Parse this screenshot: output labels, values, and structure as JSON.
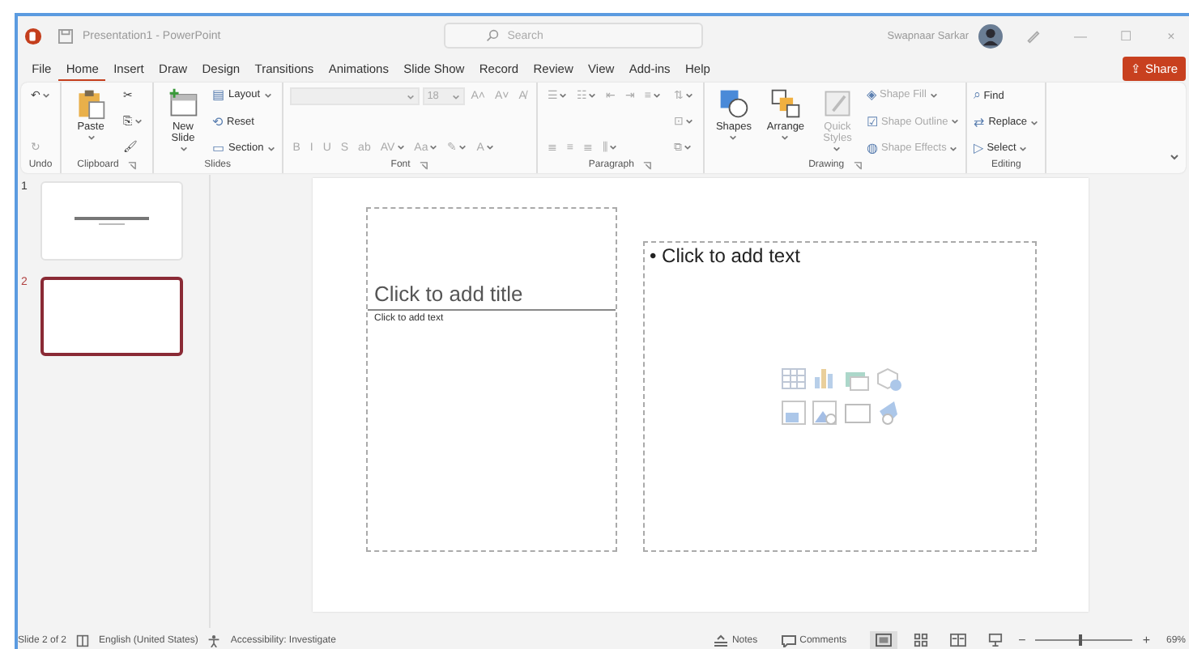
{
  "window": {
    "title": "Presentation1 - PowerPoint",
    "search_placeholder": "Search",
    "user": "Swapnaar Sarkar",
    "controls": [
      "—",
      "☐",
      "×"
    ]
  },
  "menu": [
    {
      "label": "File",
      "selected": false
    },
    {
      "label": "Home",
      "selected": true
    },
    {
      "label": "Insert",
      "selected": false
    },
    {
      "label": "Draw",
      "selected": false
    },
    {
      "label": "Design",
      "selected": false
    },
    {
      "label": "Transitions",
      "selected": false
    },
    {
      "label": "Animations",
      "selected": false
    },
    {
      "label": "Slide Show",
      "selected": false
    },
    {
      "label": "Record",
      "selected": false
    },
    {
      "label": "Review",
      "selected": false
    },
    {
      "label": "View",
      "selected": false
    },
    {
      "label": "Add-ins",
      "selected": false
    },
    {
      "label": "Help",
      "selected": false
    }
  ],
  "share": {
    "label": "Share",
    "icon": "⇪"
  },
  "ribbon": [
    {
      "label": "Undo",
      "launcher": false,
      "columns": [
        [
          [
            {
              "kind": "glyph",
              "text": "↶",
              "dropdown": true,
              "disabled": false
            }
          ],
          [
            {
              "kind": "glyph",
              "text": "↻",
              "dropdown": false,
              "disabled": true
            }
          ]
        ]
      ]
    },
    {
      "label": "Clipboard",
      "launcher": true,
      "columns": [
        [
          [
            {
              "kind": "paste",
              "label": "Paste",
              "dropdown": true,
              "disabled": false
            }
          ]
        ],
        [
          [
            {
              "kind": "glyph",
              "text": "✂",
              "dropdown": false,
              "disabled": false
            }
          ],
          [
            {
              "kind": "glyph",
              "text": "⎘",
              "dropdown": true,
              "disabled": false
            }
          ],
          [
            {
              "kind": "glyph",
              "text": "🖌",
              "dropdown": false,
              "disabled": false
            }
          ]
        ]
      ]
    },
    {
      "label": "Slides",
      "launcher": false,
      "columns": [
        [
          [
            {
              "kind": "newslide",
              "label": "New Slide",
              "dropdown": true,
              "disabled": false
            }
          ]
        ],
        [
          [
            {
              "kind": "small",
              "icon": "▤",
              "label": "Layout",
              "dropdown": true,
              "disabled": false
            }
          ],
          [
            {
              "kind": "small",
              "icon": "⟲",
              "label": "Reset",
              "dropdown": false,
              "disabled": false
            }
          ],
          [
            {
              "kind": "small",
              "icon": "▭",
              "label": "Section",
              "dropdown": true,
              "disabled": false
            }
          ]
        ]
      ]
    },
    {
      "label": "Font",
      "launcher": true,
      "columns": [
        [
          [
            {
              "kind": "field",
              "text": "",
              "wide": true,
              "disabled": true
            },
            {
              "kind": "field",
              "text": "18",
              "wide": false,
              "disabled": true
            },
            {
              "kind": "glyph",
              "text": "A˄",
              "dropdown": false,
              "disabled": true
            },
            {
              "kind": "glyph",
              "text": "A˅",
              "dropdown": false,
              "disabled": true
            },
            {
              "kind": "glyph",
              "text": "A̸",
              "dropdown": false,
              "disabled": true
            }
          ],
          [
            {
              "kind": "glyph",
              "text": "B",
              "dropdown": false,
              "disabled": true
            },
            {
              "kind": "glyph",
              "text": "I",
              "dropdown": false,
              "disabled": true
            },
            {
              "kind": "glyph",
              "text": "U",
              "dropdown": false,
              "disabled": true
            },
            {
              "kind": "glyph",
              "text": "S",
              "dropdown": false,
              "disabled": true
            },
            {
              "kind": "glyph",
              "text": "ab",
              "dropdown": false,
              "disabled": true
            },
            {
              "kind": "glyph",
              "text": "AV",
              "dropdown": true,
              "disabled": true
            },
            {
              "kind": "glyph",
              "text": "Aa",
              "dropdown": true,
              "disabled": true
            },
            {
              "kind": "glyph",
              "text": "✎",
              "dropdown": true,
              "disabled": true
            },
            {
              "kind": "glyph",
              "text": "A",
              "dropdown": true,
              "disabled": true
            }
          ]
        ]
      ]
    },
    {
      "label": "Paragraph",
      "launcher": true,
      "columns": [
        [
          [
            {
              "kind": "glyph",
              "text": "☰",
              "dropdown": true,
              "disabled": true
            },
            {
              "kind": "glyph",
              "text": "☷",
              "dropdown": true,
              "disabled": true
            },
            {
              "kind": "glyph",
              "text": "⇤",
              "dropdown": false,
              "disabled": true
            },
            {
              "kind": "glyph",
              "text": "⇥",
              "dropdown": false,
              "disabled": true
            },
            {
              "kind": "glyph",
              "text": "≡",
              "dropdown": true,
              "disabled": true
            }
          ],
          [
            {
              "kind": "glyph",
              "text": "≣",
              "dropdown": false,
              "disabled": true
            },
            {
              "kind": "glyph",
              "text": "≡",
              "dropdown": false,
              "disabled": true
            },
            {
              "kind": "glyph",
              "text": "≣",
              "dropdown": false,
              "disabled": true
            },
            {
              "kind": "glyph",
              "text": "⫼",
              "dropdown": true,
              "disabled": true
            }
          ]
        ],
        [
          [
            {
              "kind": "glyph",
              "text": "⇅",
              "dropdown": true,
              "disabled": true
            }
          ],
          [
            {
              "kind": "glyph",
              "text": "⊡",
              "dropdown": true,
              "disabled": true
            }
          ],
          [
            {
              "kind": "glyph",
              "text": "⧉",
              "dropdown": true,
              "disabled": true
            }
          ]
        ]
      ]
    },
    {
      "label": "Drawing",
      "launcher": true,
      "columns": [
        [
          [
            {
              "kind": "shapes",
              "label": "Shapes",
              "dropdown": true,
              "disabled": false
            }
          ]
        ],
        [
          [
            {
              "kind": "arrange",
              "label": "Arrange",
              "dropdown": true,
              "disabled": false
            }
          ]
        ],
        [
          [
            {
              "kind": "quickstyles",
              "label": "Quick Styles",
              "dropdown": true,
              "disabled": true
            }
          ]
        ],
        [
          [
            {
              "kind": "small",
              "icon": "◈",
              "label": "Shape Fill",
              "dropdown": true,
              "disabled": true
            }
          ],
          [
            {
              "kind": "small",
              "icon": "☑",
              "label": "Shape Outline",
              "dropdown": true,
              "disabled": true
            }
          ],
          [
            {
              "kind": "small",
              "icon": "◍",
              "label": "Shape Effects",
              "dropdown": true,
              "disabled": true
            }
          ]
        ]
      ]
    },
    {
      "label": "Editing",
      "launcher": false,
      "columns": [
        [
          [
            {
              "kind": "small",
              "icon": "⌕",
              "label": "Find",
              "dropdown": false,
              "disabled": false
            }
          ],
          [
            {
              "kind": "small",
              "icon": "⇄",
              "label": "Replace",
              "dropdown": true,
              "disabled": false
            }
          ],
          [
            {
              "kind": "small",
              "icon": "▷",
              "label": "Select",
              "dropdown": true,
              "disabled": false
            }
          ]
        ]
      ]
    }
  ],
  "slides": [
    {
      "number": "1",
      "selected": false,
      "kind": "title"
    },
    {
      "number": "2",
      "selected": true,
      "kind": "blank"
    }
  ],
  "slide": {
    "title_placeholder": "Click to add title",
    "text_placeholder": "Click to add text",
    "bullet": "•",
    "content_placeholder": "Click to add text"
  },
  "status": {
    "slide": "Slide 2 of 2",
    "language": "English (United States)",
    "accessibility": "Accessibility: Investigate",
    "notes": "Notes",
    "comments": "Comments",
    "zoom_minus": "−",
    "zoom_plus": "+",
    "zoom": "69%",
    "zoom_slider": {
      "level": 0.45
    }
  }
}
